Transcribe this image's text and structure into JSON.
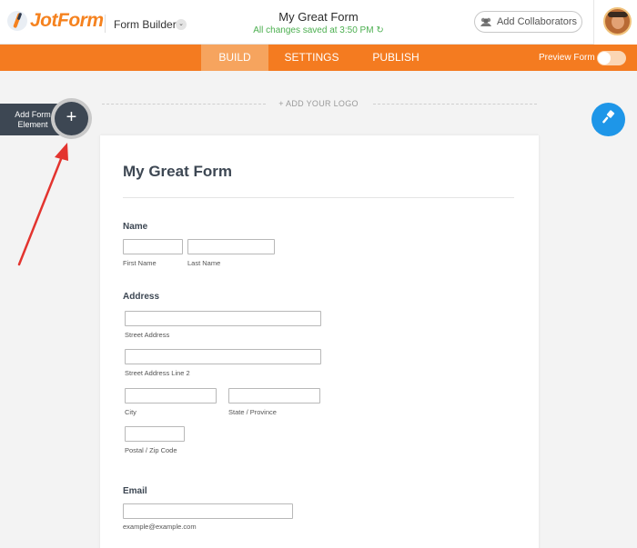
{
  "header": {
    "brand": "JotForm",
    "builder_label": "Form Builder",
    "caret": "⌄",
    "form_title": "My Great Form",
    "saved_status": "All changes saved at 3:50 PM",
    "refresh_glyph": "↻",
    "collaborators_label": "Add Collaborators"
  },
  "nav": {
    "tabs": [
      "BUILD",
      "SETTINGS",
      "PUBLISH"
    ],
    "active_tab": "BUILD",
    "preview_label": "Preview Form",
    "preview_on": false
  },
  "sidebar": {
    "add_element_label": "Add Form Element",
    "plus": "+"
  },
  "canvas": {
    "add_logo": "+ ADD YOUR LOGO"
  },
  "form": {
    "title": "My Great Form",
    "fields": {
      "name": {
        "label": "Name",
        "first": "First Name",
        "last": "Last Name"
      },
      "address": {
        "label": "Address",
        "street": "Street Address",
        "street2": "Street Address Line 2",
        "city": "City",
        "state": "State / Province",
        "zip": "Postal / Zip Code"
      },
      "email": {
        "label": "Email",
        "hint": "example@example.com"
      }
    }
  },
  "colors": {
    "brand_orange": "#f47b20",
    "active_tab": "#f6a45e",
    "dark": "#3d4753",
    "blue": "#1e96e8",
    "saved_green": "#4caf50",
    "arrow_red": "#e3342f"
  },
  "icons": {
    "collaborators": "people-icon",
    "designer": "paint-brush-icon",
    "refresh": "refresh-icon"
  }
}
